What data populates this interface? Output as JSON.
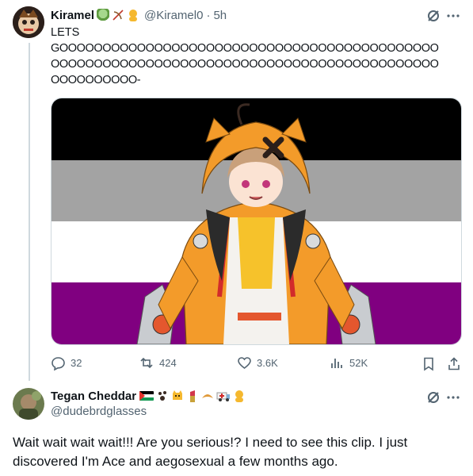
{
  "tweet": {
    "display_name": "Kiramel",
    "handle": "@Kiramel0",
    "separator": "·",
    "time": "5h",
    "text_line1": "LETS",
    "text_line2": "GOOOOOOOOOOOOOOOOOOOOOOOOOOOOOOOOOOOOOOOOOOOO",
    "text_line3": "OOOOOOOOOOOOOOOOOOOOOOOOOOOOOOOOOOOOOOOOOOOOO",
    "text_line4": "OOOOOOOOOO-",
    "name_emojis": [
      "bowl-icon",
      "bow-icon",
      "person-icon"
    ],
    "image": {
      "flag_colors": [
        "#000000",
        "#a3a3a3",
        "#ffffff",
        "#800080"
      ]
    },
    "actions": {
      "replies": "32",
      "reposts": "424",
      "likes": "3.6K",
      "views": "52K"
    }
  },
  "reply": {
    "display_name": "Tegan Cheddar",
    "handle": "@dudebrdglasses",
    "name_emojis": [
      "flag-icon",
      "paws-icon",
      "cat-icon",
      "lipstick-icon",
      "croissant-icon",
      "ambulance-icon",
      "person-icon"
    ],
    "text_line1": "Wait wait wait wait!!! Are you serious!? I need to see this clip. I just",
    "text_line2": "discovered I'm Ace and aegosexual a few months ago."
  },
  "colors": {
    "text": "#0f1419",
    "muted": "#536471",
    "divider": "#eff3f4",
    "thread": "#cfd9de"
  }
}
